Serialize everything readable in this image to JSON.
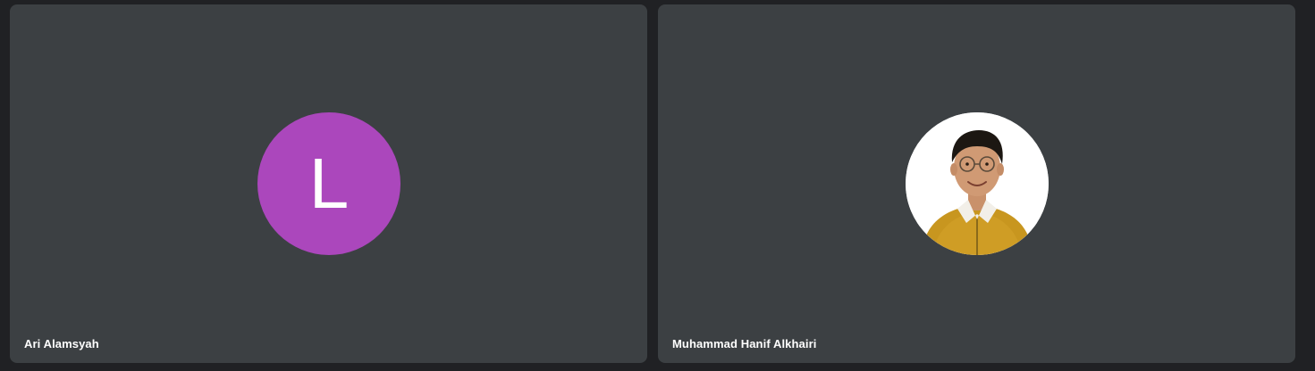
{
  "participants": [
    {
      "name": "Ari Alamsyah",
      "avatar_letter": "L",
      "avatar_color": "#ab47bc",
      "avatar_type": "initial"
    },
    {
      "name": "Muhammad Hanif Alkhairi",
      "avatar_type": "photo",
      "avatar_icon": "profile-photo"
    }
  ],
  "colors": {
    "background": "#202124",
    "tile": "#3c4043",
    "name_text": "#ffffff"
  }
}
